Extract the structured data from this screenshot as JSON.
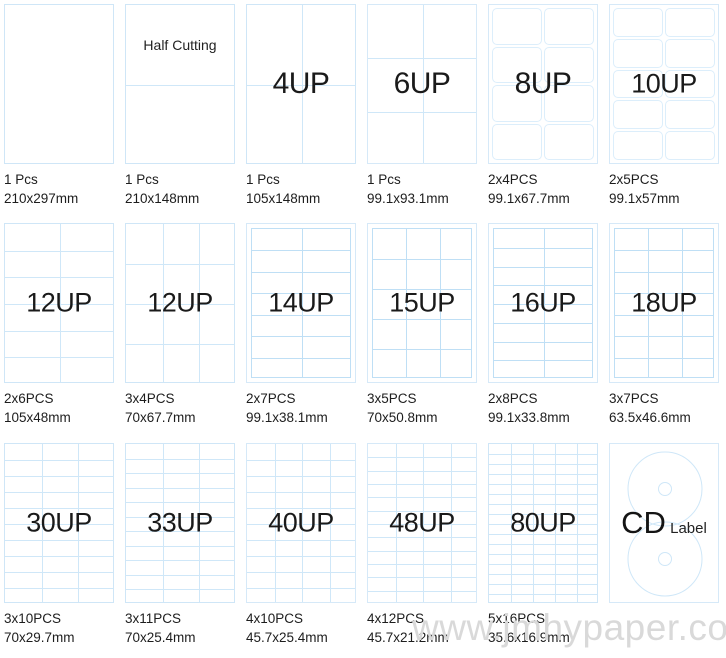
{
  "watermark": "www.jmhypaper.com",
  "labels": {
    "half_cutting": "Half Cutting",
    "cd_big": "CD",
    "cd_small": "Label"
  },
  "items": [
    {
      "title": "",
      "pcs": "1 Pcs",
      "size": "210x297mm",
      "cols": 1,
      "rows": 1,
      "style": "plain"
    },
    {
      "title": "Half Cutting",
      "pcs": "1 Pcs",
      "size": "210x148mm",
      "cols": 1,
      "rows": 2,
      "style": "plain"
    },
    {
      "title": "4UP",
      "pcs": "1 Pcs",
      "size": "105x148mm",
      "cols": 2,
      "rows": 2,
      "style": "plain"
    },
    {
      "title": "6UP",
      "pcs": "1 Pcs",
      "size": "99.1x93.1mm",
      "cols": 2,
      "rows": 3,
      "style": "framed"
    },
    {
      "title": "8UP",
      "pcs": "2x4PCS",
      "size": "99.1x67.7mm",
      "cols": 2,
      "rows": 4,
      "style": "rounded"
    },
    {
      "title": "10UP",
      "pcs": "2x5PCS",
      "size": "99.1x57mm",
      "cols": 2,
      "rows": 5,
      "style": "rounded"
    },
    {
      "title": "12UP",
      "pcs": "2x6PCS",
      "size": "105x48mm",
      "cols": 2,
      "rows": 6,
      "style": "plain"
    },
    {
      "title": "12UP",
      "pcs": "3x4PCS",
      "size": "70x67.7mm",
      "cols": 3,
      "rows": 4,
      "style": "plain"
    },
    {
      "title": "14UP",
      "pcs": "2x7PCS",
      "size": "99.1x38.1mm",
      "cols": 2,
      "rows": 7,
      "style": "inset"
    },
    {
      "title": "15UP",
      "pcs": "3x5PCS",
      "size": "70x50.8mm",
      "cols": 3,
      "rows": 5,
      "style": "inset"
    },
    {
      "title": "16UP",
      "pcs": "2x8PCS",
      "size": "99.1x33.8mm",
      "cols": 2,
      "rows": 8,
      "style": "inset"
    },
    {
      "title": "18UP",
      "pcs": "3x7PCS",
      "size": "63.5x46.6mm",
      "cols": 3,
      "rows": 7,
      "style": "inset"
    },
    {
      "title": "30UP",
      "pcs": "3x10PCS",
      "size": "70x29.7mm",
      "cols": 3,
      "rows": 10,
      "style": "plain"
    },
    {
      "title": "33UP",
      "pcs": "3x11PCS",
      "size": "70x25.4mm",
      "cols": 3,
      "rows": 11,
      "style": "plain"
    },
    {
      "title": "40UP",
      "pcs": "4x10PCS",
      "size": "45.7x25.4mm",
      "cols": 4,
      "rows": 10,
      "style": "framed"
    },
    {
      "title": "48UP",
      "pcs": "4x12PCS",
      "size": "45.7x21.2mm",
      "cols": 4,
      "rows": 12,
      "style": "framed"
    },
    {
      "title": "80UP",
      "pcs": "5x16PCS",
      "size": "35.6x16.9mm",
      "cols": 5,
      "rows": 16,
      "style": "plain"
    },
    {
      "title": "CD Label",
      "pcs": "",
      "size": "",
      "cols": 0,
      "rows": 0,
      "style": "cd"
    }
  ]
}
